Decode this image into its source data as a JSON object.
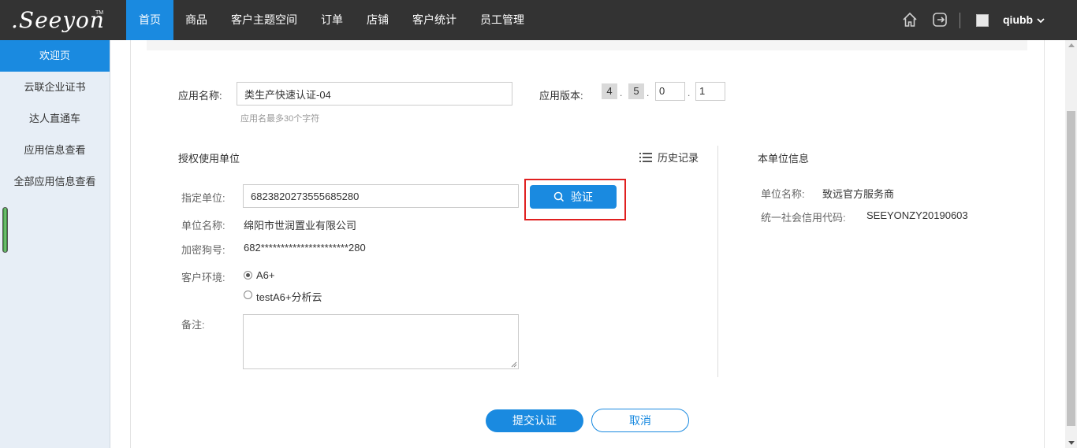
{
  "brand": {
    "logo_text": ".Seeyon",
    "logo_tm": "TM"
  },
  "nav": {
    "items": [
      {
        "label": "首页",
        "active": true
      },
      {
        "label": "商品"
      },
      {
        "label": "客户主题空间"
      },
      {
        "label": "订单"
      },
      {
        "label": "店铺"
      },
      {
        "label": "客户统计"
      },
      {
        "label": "员工管理"
      }
    ],
    "user": {
      "name": "qiubb"
    },
    "icons": [
      "home-icon",
      "logout-icon",
      "chevron-down-icon"
    ]
  },
  "sidebar": {
    "items": [
      {
        "label": "欢迎页",
        "active": true
      },
      {
        "label": "云联企业证书"
      },
      {
        "label": "达人直通车"
      },
      {
        "label": "应用信息查看"
      },
      {
        "label": "全部应用信息查看"
      }
    ]
  },
  "form": {
    "app_name_label": "应用名称:",
    "app_name_value": "类生产快速认证-04",
    "app_name_hint": "应用名最多30个字符",
    "app_version_label": "应用版本:",
    "version": [
      "4",
      "5",
      "0",
      "1"
    ],
    "version_sep": ".",
    "auth_section_title": "授权使用单位",
    "history_label": "历史记录",
    "unit_label": "指定单位:",
    "unit_value": "6823820273555685280",
    "verify_label": "验证",
    "unit_name_label": "单位名称:",
    "unit_name_value": "绵阳市世润置业有限公司",
    "dongle_label": "加密狗号:",
    "dongle_value": "682**********************280",
    "env_label": "客户环境:",
    "env_options": [
      {
        "label": "A6+",
        "checked": true
      },
      {
        "label": "testA6+分析云",
        "checked": false
      }
    ],
    "remark_label": "备注:",
    "remark_value": "",
    "submit_label": "提交认证",
    "cancel_label": "取消"
  },
  "own_unit": {
    "title": "本单位信息",
    "name_label": "单位名称:",
    "name_value": "致远官方服务商",
    "credit_label": "统一社会信用代码:",
    "credit_value": "SEEYONZY20190603"
  },
  "colors": {
    "primary": "#1a8ae0",
    "topbar": "#333333",
    "sidebar": "#e7eef6",
    "highlight": "#e02020"
  }
}
